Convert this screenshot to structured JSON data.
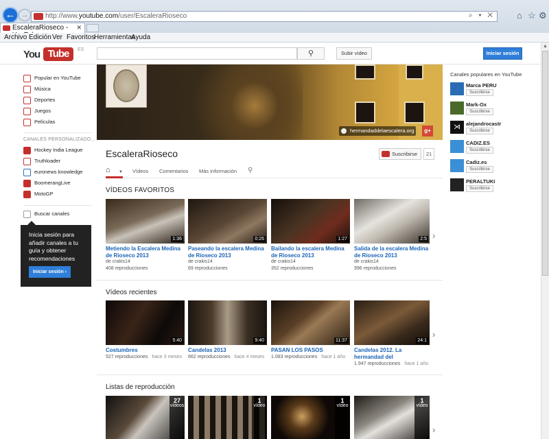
{
  "browser": {
    "url_prefix": "http://www.",
    "url_domain": "youtube.com",
    "url_path": "/user/EscaleraRioseco",
    "url_controls": "⌕ ▾ ✕",
    "tab_title": "EscaleraRioseco - YouTube",
    "tab_close": "✕",
    "menu": [
      "Archivo",
      "Edición",
      "Ver",
      "Favoritos",
      "Herramientas",
      "Ayuda"
    ]
  },
  "header": {
    "logo_you": "You",
    "logo_tube": "Tube",
    "logo_locale": "ES",
    "search_placeholder": "",
    "upload_label": "Subir vídeo",
    "login_label": "Iniciar sesión"
  },
  "guide": {
    "items": [
      {
        "label": "Popular en YouTube",
        "icon": "popular-icon"
      },
      {
        "label": "Música",
        "icon": "music-icon"
      },
      {
        "label": "Deportes",
        "icon": "sports-icon"
      },
      {
        "label": "Juegos",
        "icon": "games-icon"
      },
      {
        "label": "Películas",
        "icon": "movies-icon"
      }
    ],
    "section_title": "CANALES PERSONALIZADO...",
    "channels": [
      {
        "label": "Hockey India League"
      },
      {
        "label": "Truthloader"
      },
      {
        "label": "euronews knowledge"
      },
      {
        "label": "BoomerangLive"
      },
      {
        "label": "MotoGP"
      }
    ],
    "browse_label": "Buscar canales",
    "promo_text": "Inicia sesión para añadir canales a tu guía y obtener recomendaciones",
    "promo_button": "Iniciar sesión ›"
  },
  "channel": {
    "name": "EscaleraRioseco",
    "site_link": "hermandaddelaescalera.org",
    "gplus": "g+",
    "subscribe_label": "Suscribirse",
    "subscriber_count": "21",
    "tabs": [
      "Vídeos",
      "Comentarios",
      "Más información"
    ]
  },
  "sections": {
    "favorites_title": "VÍDEOS FAVORITOS",
    "recent_title": "Vídeos recientes",
    "playlists_title": "Listas de reproducción"
  },
  "favorites": [
    {
      "title": "Metiendo la Escalera Medina de Rioseco 2013",
      "duration": "1:36",
      "author": "de crakis14",
      "views": "408 reproducciones"
    },
    {
      "title": "Paseando la escalera Medina de Rioseco 2013",
      "duration": "0:26",
      "author": "de crakis14",
      "views": "69 reproducciones"
    },
    {
      "title": "Bailando la escalera Medina de Rioseco 2013",
      "duration": "1:27",
      "author": "de crakis14",
      "views": "352 reproducciones"
    },
    {
      "title": "Salida de la escalera Medina de Rioseco 2013",
      "duration": "2:5",
      "author": "de crakis14",
      "views": "996 reproducciones"
    }
  ],
  "recent": [
    {
      "title": "Costumbres",
      "duration": "5:40",
      "views": "527 reproducciones",
      "ago": "hace 3 meses"
    },
    {
      "title": "Candelas 2013",
      "duration": "9:40",
      "views": "662 reproducciones",
      "ago": "hace 4 meses"
    },
    {
      "title": "PASAN LOS PASOS",
      "duration": "11:37",
      "views": "1.083 reproducciones",
      "ago": "hace 1 año"
    },
    {
      "title": "Candelas 2012. La hermandad del Descendimi...",
      "duration": "24:1",
      "views": "1.947 reproducciones",
      "ago": "hace 1 año"
    }
  ],
  "playlists": [
    {
      "count": "27",
      "unit": "vídeos"
    },
    {
      "count": "1",
      "unit": "vídeo"
    },
    {
      "count": "1",
      "unit": "vídeo"
    },
    {
      "count": "1",
      "unit": "vídeo"
    }
  ],
  "sidebar_right": {
    "title": "Canales populares en YouTube",
    "subscribe_label": "Suscribirse",
    "channels": [
      {
        "name": "Marca PERU",
        "color": "#2a6db5"
      },
      {
        "name": "Mark-Ox",
        "color": "#4a6a2a"
      },
      {
        "name": "alejandrocastr",
        "color": "#111111"
      },
      {
        "name": "CADIZ.ES",
        "color": "#3b8fd6"
      },
      {
        "name": "Cadiz.es",
        "color": "#3b8fd6"
      },
      {
        "name": "PERALTUKI",
        "color": "#222222"
      }
    ]
  },
  "colors": {
    "brand_red": "#c4302b",
    "link_blue": "#1b64b6",
    "button_blue": "#2f7ed9"
  }
}
